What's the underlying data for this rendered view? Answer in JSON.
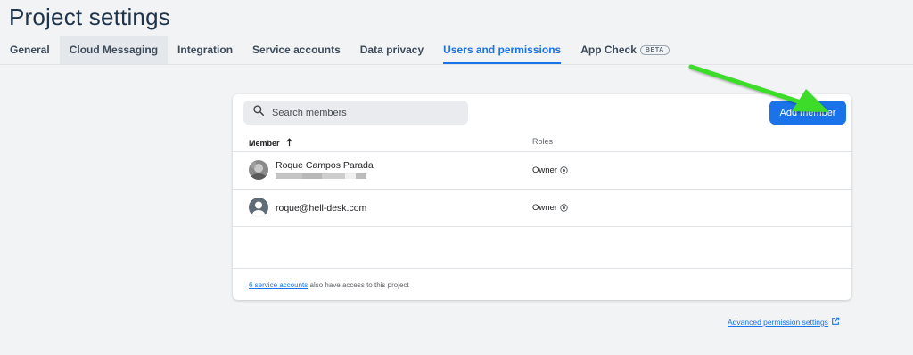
{
  "page": {
    "title": "Project settings"
  },
  "tabs": [
    {
      "label": "General"
    },
    {
      "label": "Cloud Messaging"
    },
    {
      "label": "Integration"
    },
    {
      "label": "Service accounts"
    },
    {
      "label": "Data privacy"
    },
    {
      "label": "Users and permissions"
    },
    {
      "label": "App Check",
      "badge": "BETA"
    }
  ],
  "active_tab": "Users and permissions",
  "search": {
    "placeholder": "Search members",
    "value": ""
  },
  "add_button": {
    "label": "Add member"
  },
  "table": {
    "columns": {
      "member": "Member",
      "roles": "Roles"
    },
    "rows": [
      {
        "name": "Roque Campos Parada",
        "email_redacted": true,
        "role": "Owner",
        "avatar": "photo-avatar"
      },
      {
        "name": "roque@hell-desk.com",
        "role": "Owner",
        "avatar": "default-person-avatar"
      }
    ]
  },
  "footer": {
    "link_text": "6 service accounts",
    "text": " also have access to this project"
  },
  "advanced_link": {
    "label": "Advanced permission settings",
    "icon": "open-in-new-icon"
  },
  "colors": {
    "accent": "#1a73e8",
    "annotation_arrow": "#3ddc2a",
    "background": "#f1f3f5"
  }
}
